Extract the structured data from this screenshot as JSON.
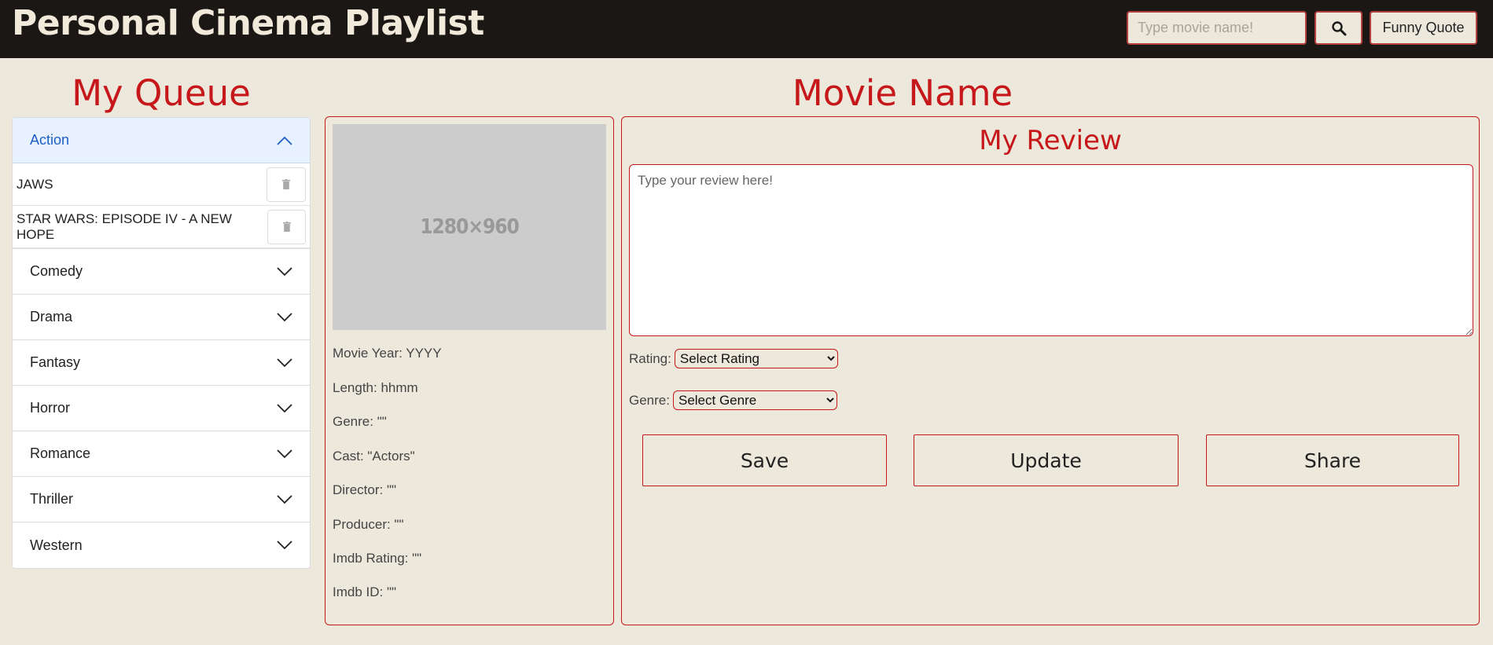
{
  "header": {
    "title": "Personal Cinema Playlist",
    "search_placeholder": "Type movie name!",
    "quote_label": "Funny Quote"
  },
  "queue": {
    "heading": "My Queue",
    "open_category": "Action",
    "open_items": [
      "JAWS",
      "STAR WARS: EPISODE IV - A NEW HOPE"
    ],
    "categories": [
      "Comedy",
      "Drama",
      "Fantasy",
      "Horror",
      "Romance",
      "Thriller",
      "Western"
    ]
  },
  "movie": {
    "heading": "Movie Name",
    "poster_label": "1280×960",
    "info": [
      "Movie Year: YYYY",
      "Length: hhmm",
      "Genre: \"\"",
      "Cast: \"Actors\"",
      "Director: \"\"",
      "Producer: \"\"",
      "Imdb Rating: \"\"",
      "Imdb ID: \"\""
    ]
  },
  "review": {
    "title": "My Review",
    "placeholder": "Type your review here!",
    "rating_label": "Rating:",
    "rating_selected": "Select Rating",
    "genre_label": "Genre:",
    "genre_selected": "Select Genre",
    "save_label": "Save",
    "update_label": "Update",
    "share_label": "Share"
  },
  "colors": {
    "accent": "#c6181b",
    "header_bg": "#1b1715",
    "page_bg": "#ede8dc",
    "open_tab_text": "#1d5fc4"
  }
}
